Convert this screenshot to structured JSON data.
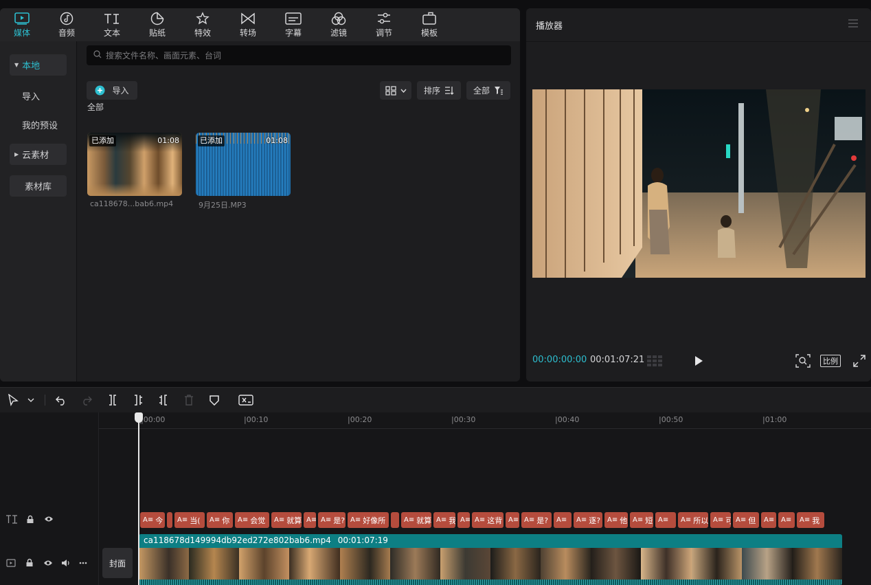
{
  "toolbar": {
    "items": [
      {
        "label": "媒体",
        "icon": "media-icon"
      },
      {
        "label": "音频",
        "icon": "audio-icon"
      },
      {
        "label": "文本",
        "icon": "text-icon"
      },
      {
        "label": "贴纸",
        "icon": "sticker-icon"
      },
      {
        "label": "特效",
        "icon": "effects-icon"
      },
      {
        "label": "转场",
        "icon": "transition-icon"
      },
      {
        "label": "字幕",
        "icon": "subtitle-icon"
      },
      {
        "label": "滤镜",
        "icon": "filter-icon"
      },
      {
        "label": "调节",
        "icon": "adjust-icon"
      },
      {
        "label": "模板",
        "icon": "template-icon"
      }
    ],
    "active_color": "#2dbfd0"
  },
  "sidebar": {
    "local": "本地",
    "import": "导入",
    "my_presets": "我的预设",
    "cloud": "云素材",
    "library": "素材库"
  },
  "media": {
    "search_placeholder": "搜索文件名称、画面元素、台词",
    "import_label": "导入",
    "sort_label": "排序",
    "filter_label": "全部",
    "section_label": "全部",
    "items": [
      {
        "badge": "已添加",
        "duration": "01:08",
        "name": "ca118678...bab6.mp4"
      },
      {
        "badge": "已添加",
        "duration": "01:08",
        "name": "9月25日.MP3"
      }
    ]
  },
  "player": {
    "title": "播放器",
    "current_time": "00:00:00:00",
    "total_time": "00:01:07:21",
    "ratio_label": "比例"
  },
  "timeline": {
    "ruler": [
      "|00:00",
      "|00:10",
      "|00:20",
      "|00:30",
      "|00:40",
      "|00:50",
      "|01:00"
    ],
    "subtitles": [
      "今",
      "",
      "当(",
      "你",
      "会觉",
      "就算",
      "",
      "是?",
      "好像所",
      "",
      "就算",
      "我",
      "",
      "这背",
      "",
      "是?",
      "",
      "逐?",
      "他",
      "短",
      "",
      "所以",
      "可",
      "但",
      "",
      "",
      "我"
    ],
    "video_clip": {
      "name": "ca118678d149994db92ed272e802bab6.mp4",
      "duration": "00:01:07:19"
    },
    "cover_label": "封面"
  }
}
